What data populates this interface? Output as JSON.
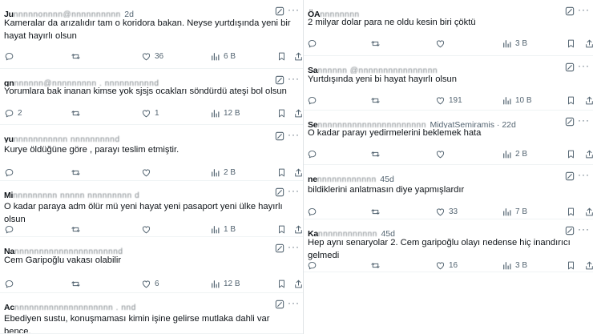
{
  "left_tweets": [
    {
      "name": "Ju",
      "garble": "nnnnnonnnn@nnnnnnnnnn",
      "time": "2d",
      "text": "Kameralar da arızalıdır tam o koridora bakan. Neyse yurtdışında yeni bir hayat hayırlı olsun",
      "replies": "",
      "reposts": "",
      "likes": "36",
      "views": "6 B"
    },
    {
      "name": "gn",
      "garble": "nnnnnn@nnnnnnnnn . nnnnnnnnnnd",
      "time": "",
      "text": "Yorumlara bak inanan kimse yok sjsjs ocakları söndürdü ateşi bol olsun",
      "replies": "2",
      "reposts": "",
      "likes": "1",
      "views": "12 B"
    },
    {
      "name": "yu",
      "garble": "nnnnnnnnnnn nnnnnnnnnd",
      "time": "",
      "text": "Kurye öldüğüne göre , parayı teslim etmiştir.",
      "replies": "",
      "reposts": "",
      "likes": "",
      "views": "2 B"
    },
    {
      "name": "Mi",
      "garble": "nnnnnnnnn nnnnn nnnnnnnnn d",
      "time": "",
      "text": "O kadar paraya adm ölür mü yeni hayat yeni pasaport yeni ülke hayırlı olsun",
      "replies": "",
      "reposts": "",
      "likes": "",
      "views": "1 B"
    },
    {
      "name": "Na",
      "garble": "nnnnnnnnnnnnnnnnnnnnnd",
      "time": "",
      "text": "Cem Garipoğlu vakası olabilir",
      "replies": "",
      "reposts": "",
      "likes": "6",
      "views": "12 B"
    },
    {
      "name": "Ac",
      "garble": "nnnnnnnnnnnnnnnnnnnn . nnd",
      "time": "",
      "text": "Ebediyen sustu, konuşmaması kimin işine gelirse mutlaka dahli var bence.",
      "replies": "",
      "reposts": "",
      "likes": "",
      "views": ""
    }
  ],
  "right_tweets": [
    {
      "name": "ÖA",
      "garble": "nnnnnnnn",
      "time": "",
      "text": "2 milyar dolar para ne oldu kesin biri çöktü",
      "replies": "",
      "reposts": "",
      "likes": "",
      "views": "3 B"
    },
    {
      "name": "Sa",
      "garble": "nnnnnn @nnnnnnnnnnnnnnnn",
      "time": "",
      "text": "Yurtdışında yeni bi hayat hayırlı olsun",
      "replies": "",
      "reposts": "",
      "likes": "191",
      "views": "10 B"
    },
    {
      "name": "Se",
      "garble": "nnnnnnnnnnnnnnnnnnnnnn",
      "time": "MidyatSemiramis · 22d",
      "text": "O kadar parayı yedirmelerini beklemek hata",
      "replies": "",
      "reposts": "",
      "likes": "",
      "views": "2 B"
    },
    {
      "name": "ne",
      "garble": "nnnnnnnnnnnn",
      "time": "45d",
      "text": "bildiklerini anlatmasın diye yapmışlardır",
      "replies": "",
      "reposts": "",
      "likes": "33",
      "views": "7 B"
    },
    {
      "name": "Ka",
      "garble": "nnnnnnnnnnnn",
      "time": "45d",
      "text": "Hep aynı senaryolar 2. Cem garipoğlu olayı nedense hiç inandırıcı gelmedi",
      "replies": "",
      "reposts": "",
      "likes": "16",
      "views": "3 B"
    }
  ],
  "more_glyph": "···",
  "icons": [
    "reply-icon",
    "repost-icon",
    "like-icon",
    "views-icon",
    "bookmark-icon",
    "share-icon",
    "grok-icon"
  ],
  "colors": {
    "text": "#0f1419",
    "muted": "#536471",
    "divider": "#eff3f4"
  }
}
